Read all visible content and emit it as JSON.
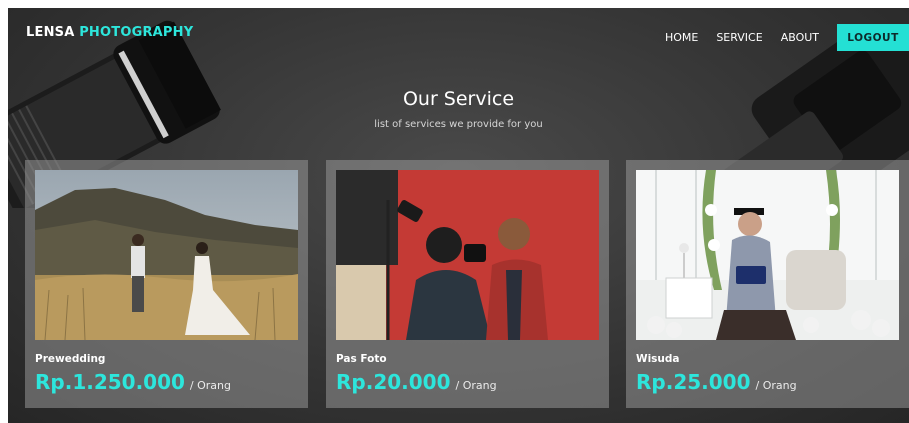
{
  "header": {
    "brand_main": "LENSA",
    "brand_accent": "PHOTOGRAPHY",
    "nav": [
      "HOME",
      "SERVICE",
      "ABOUT"
    ],
    "logout_label": "LOGOUT"
  },
  "section": {
    "title": "Our Service",
    "subtitle": "list of services we provide for you"
  },
  "services": [
    {
      "name": "Prewedding",
      "price": "Rp.1.250.000",
      "unit": "/ Orang",
      "photo": "couple-in-grass-field-photo"
    },
    {
      "name": "Pas Foto",
      "price": "Rp.20.000",
      "unit": "/ Orang",
      "photo": "photographer-in-studio-photo"
    },
    {
      "name": "Wisuda",
      "price": "Rp.25.000",
      "unit": "/ Orang",
      "photo": "graduate-in-white-room-photo"
    }
  ],
  "colors": {
    "accent": "#2de6dc",
    "background": "#3a3a3a",
    "logout_bg": "#24e0d4"
  }
}
